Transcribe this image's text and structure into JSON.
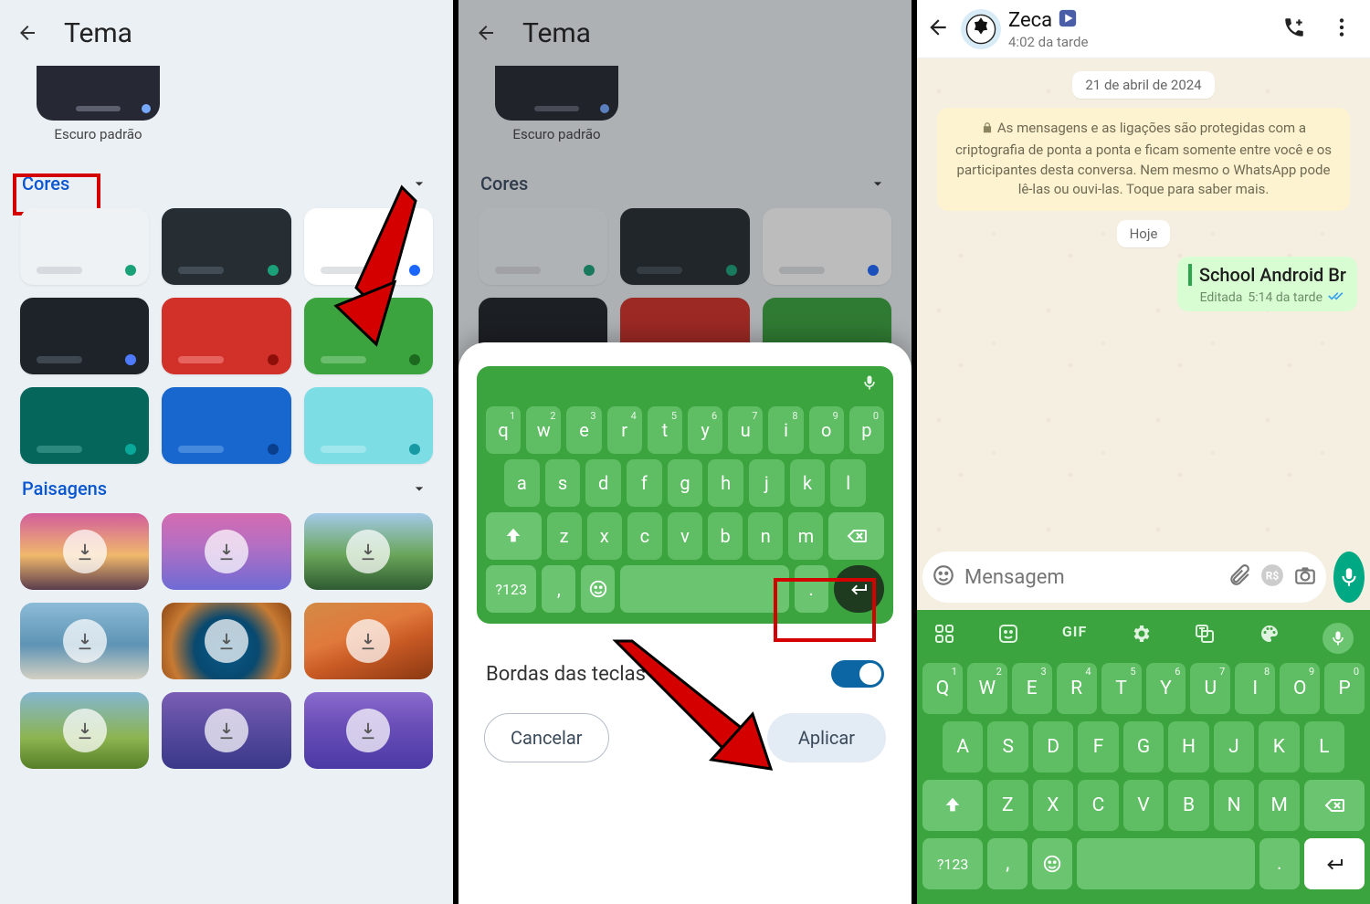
{
  "screen1": {
    "title": "Tema",
    "dark_default": "Escuro padrão",
    "section_cores": "Cores",
    "section_paisagens": "Paisagens"
  },
  "screen2": {
    "title": "Tema",
    "dark_default": "Escuro padrão",
    "section_cores": "Cores",
    "bordas": "Bordas das teclas",
    "cancel": "Cancelar",
    "apply": "Aplicar",
    "keys_row1": [
      {
        "k": "q",
        "s": "1"
      },
      {
        "k": "w",
        "s": "2"
      },
      {
        "k": "e",
        "s": "3"
      },
      {
        "k": "r",
        "s": "4"
      },
      {
        "k": "t",
        "s": "5"
      },
      {
        "k": "y",
        "s": "6"
      },
      {
        "k": "u",
        "s": "7"
      },
      {
        "k": "i",
        "s": "8"
      },
      {
        "k": "o",
        "s": "9"
      },
      {
        "k": "p",
        "s": "0"
      }
    ],
    "keys_row2": [
      "a",
      "s",
      "d",
      "f",
      "g",
      "h",
      "j",
      "k",
      "l"
    ],
    "keys_row3": [
      "z",
      "x",
      "c",
      "v",
      "b",
      "n",
      "m"
    ],
    "sym": "?123",
    "comma": ",",
    "period": "."
  },
  "screen3": {
    "contact": "Zeca",
    "time": "4:02 da tarde",
    "date_pill": "21 de abril de 2024",
    "encryption": "As mensagens e as ligações são protegidas com a criptografia de ponta a ponta e ficam somente entre você e os participantes desta conversa. Nem mesmo o WhatsApp pode lê-las ou ouvi-las. Toque para saber mais.",
    "today": "Hoje",
    "msg_text": "School Android Br",
    "msg_edited": "Editada",
    "msg_time": "5:14 da tarde",
    "placeholder": "Mensagem",
    "gif": "GIF",
    "sym": "?123",
    "comma": ",",
    "period": ".",
    "keys_row1": [
      {
        "k": "Q",
        "s": "1"
      },
      {
        "k": "W",
        "s": "2"
      },
      {
        "k": "E",
        "s": "3"
      },
      {
        "k": "R",
        "s": "4"
      },
      {
        "k": "T",
        "s": "5"
      },
      {
        "k": "Y",
        "s": "6"
      },
      {
        "k": "U",
        "s": "7"
      },
      {
        "k": "I",
        "s": "8"
      },
      {
        "k": "O",
        "s": "9"
      },
      {
        "k": "P",
        "s": "0"
      }
    ],
    "keys_row2": [
      "A",
      "S",
      "D",
      "F",
      "G",
      "H",
      "J",
      "K",
      "L"
    ],
    "keys_row3": [
      "Z",
      "X",
      "C",
      "V",
      "B",
      "N",
      "M"
    ]
  }
}
